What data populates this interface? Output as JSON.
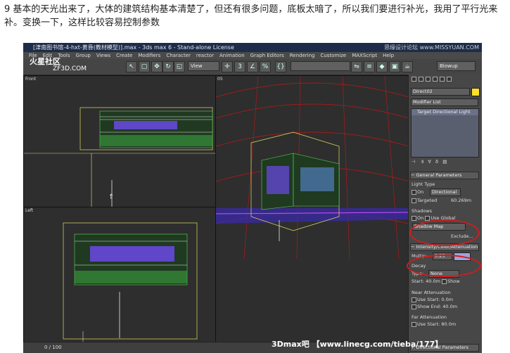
{
  "caption": "9 基本的天光出来了，大体的建筑结构基本清楚了，但还有很多问题，底板太暗了，所以我们要进行补光，我用了平行光来补。变换一下，这样比较容易控制参数",
  "window": {
    "title": "[津南图书馆-4-hxt-黄昏(教材模型)].max - 3ds max 6 - Stand-alone License",
    "site_watermark": "思缘设计论坛 www.MISSYUAN.COM"
  },
  "logo": {
    "text1": "火星社区",
    "text2": "ZF3D.COM"
  },
  "menu": [
    "File",
    "Edit",
    "Tools",
    "Group",
    "Views",
    "Create",
    "Modifiers",
    "Character",
    "reactor",
    "Animation",
    "Graph Editors",
    "Rendering",
    "Customize",
    "MAXScript",
    "Help"
  ],
  "toolbar": {
    "view_combo": "View",
    "right_combo": "Blowup"
  },
  "viewports": {
    "front": "Front",
    "persp": "05",
    "left": "Left"
  },
  "command_panel": {
    "object_name": "Direct02",
    "color": "#ffe02a",
    "modifier_list": "Modifier List",
    "stack_item": "Target Directional Light",
    "general_params": "General Parameters",
    "light_type": "Light Type",
    "on_label": "On",
    "type_value": "Directional",
    "targeted_label": "Targeted",
    "targeted_value": "60.269m",
    "shadows_label": "Shadows",
    "shadows_on": "On",
    "use_global": "Use Global",
    "shadow_map": "Shadow Map",
    "exclude": "Exclude...",
    "intensity_rollout": "Intensity/Color/Attenuation",
    "multiplier_label": "Multip:",
    "multiplier_value": "0.25",
    "multiplier_color": "#9ea3dc",
    "decay_label": "Decay",
    "decay_type_label": "Type:",
    "decay_type_value": "None",
    "start_label": "Start:",
    "start_value": "40.0m",
    "show_label": "Show",
    "near_atten": "Near Attenuation",
    "near_use": "Use",
    "near_start_label": "Start:",
    "near_start_value": "0.0m",
    "near_show": "Show",
    "near_end_label": "End:",
    "near_end_value": "40.0m",
    "far_atten": "Far Attenuation",
    "far_use": "Use",
    "far_start_label": "Start:",
    "far_start_value": "80.0m",
    "directional_params": "Directional Parameters"
  },
  "timeline": {
    "frame": "0 / 100"
  },
  "watermark": "3Dmax吧 【www.linecg.com/tieba/177】"
}
